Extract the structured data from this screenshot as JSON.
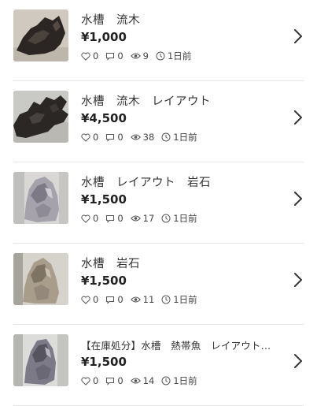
{
  "currency_symbol": "¥",
  "items": [
    {
      "title": "水槽　流木",
      "price": "¥1,000",
      "likes": "0",
      "comments": "0",
      "views": "9",
      "time": "1日前"
    },
    {
      "title": "水槽　流木　レイアウト",
      "price": "¥4,500",
      "likes": "0",
      "comments": "0",
      "views": "38",
      "time": "1日前"
    },
    {
      "title": "水槽　レイアウト　岩石",
      "price": "¥1,500",
      "likes": "0",
      "comments": "0",
      "views": "17",
      "time": "1日前"
    },
    {
      "title": "水槽　岩石",
      "price": "¥1,500",
      "likes": "0",
      "comments": "0",
      "views": "11",
      "time": "1日前"
    },
    {
      "title": "【在庫処分】水槽　熱帯魚　レイアウト…",
      "price": "¥1,500",
      "likes": "0",
      "comments": "0",
      "views": "14",
      "time": "1日前"
    }
  ]
}
